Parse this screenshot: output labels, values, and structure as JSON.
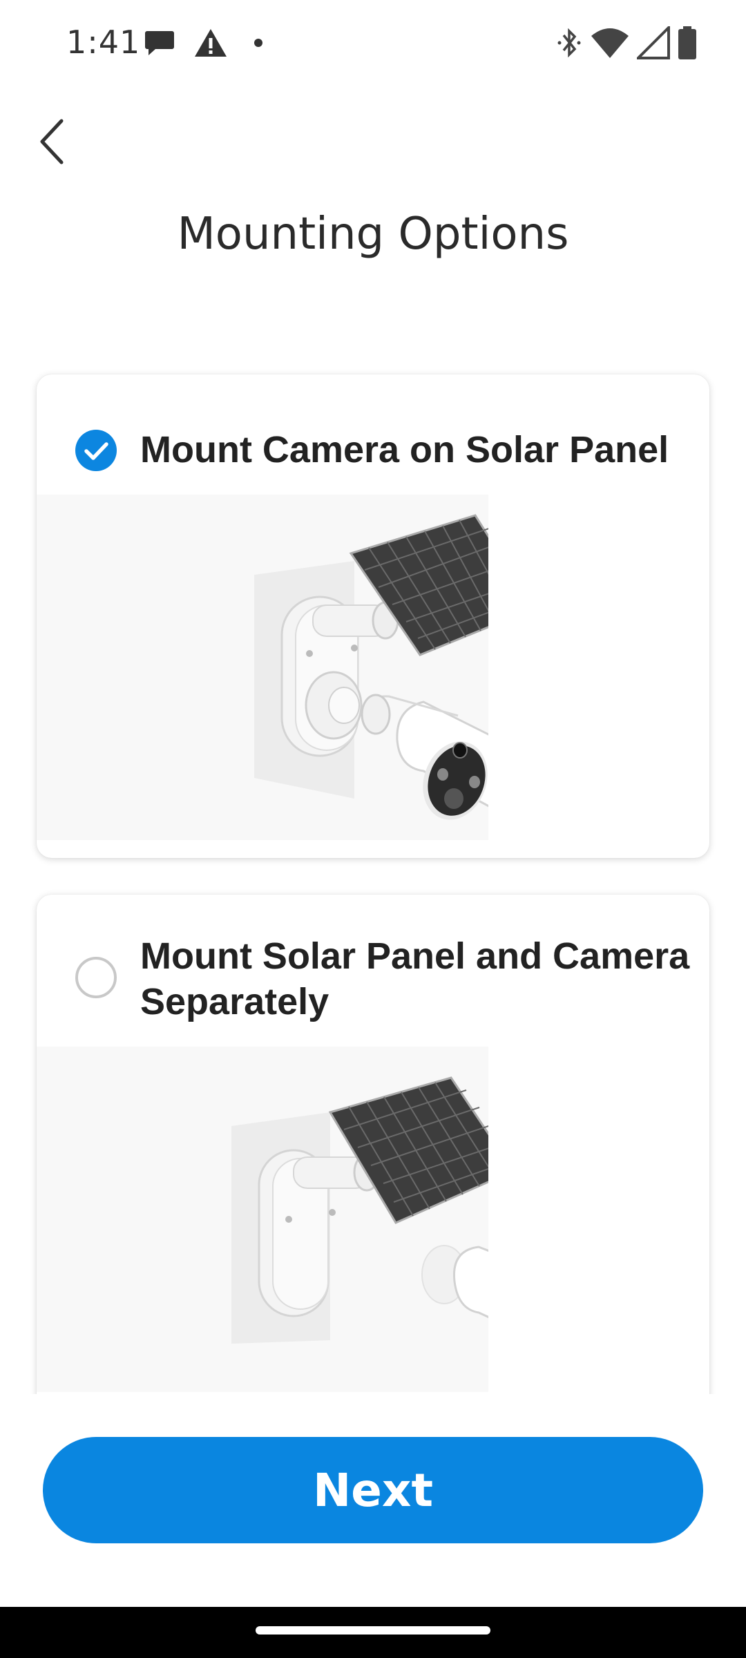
{
  "status_bar": {
    "time": "1:41",
    "left_icons": [
      "chat-bubble-icon",
      "warning-icon",
      "dot-icon"
    ],
    "right_icons": [
      "bluetooth-icon",
      "wifi-icon",
      "cell-signal-icon",
      "battery-icon"
    ]
  },
  "header": {
    "back_icon": "chevron-left-icon",
    "title": "Mounting Options"
  },
  "options": [
    {
      "label": "Mount Camera on Solar Panel",
      "selected": true
    },
    {
      "label": "Mount Solar Panel and Camera Separately",
      "selected": false
    }
  ],
  "footer": {
    "next_label": "Next"
  },
  "colors": {
    "accent": "#0a86e0",
    "radio_unchecked": "#c8c8c8",
    "nav_bar": "#000000"
  }
}
